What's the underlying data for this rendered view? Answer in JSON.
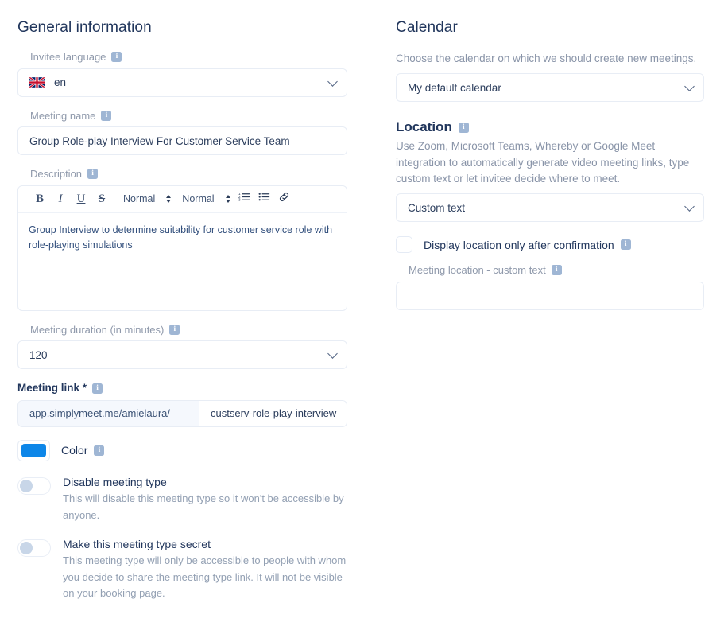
{
  "left": {
    "section_title": "General information",
    "invitee_language": {
      "label": "Invitee language",
      "value": "en",
      "flag": "uk-flag-icon"
    },
    "meeting_name": {
      "label": "Meeting name",
      "value": "Group Role-play Interview For Customer Service Team"
    },
    "description": {
      "label": "Description",
      "toolbar": {
        "bold": "B",
        "italic": "I",
        "underline": "U",
        "strike": "S",
        "font_select": "Normal",
        "size_select": "Normal"
      },
      "value": "Group Interview to determine suitability for customer service role with role-playing simulations"
    },
    "meeting_duration": {
      "label": "Meeting duration (in minutes)",
      "value": "120"
    },
    "meeting_link": {
      "label": "Meeting link *",
      "prefix": "app.simplymeet.me/amielaura/",
      "slug": "custserv-role-play-interview"
    },
    "color": {
      "label": "Color",
      "value": "#0d86e8"
    },
    "disable_meeting_type": {
      "title": "Disable meeting type",
      "description": "This will disable this meeting type so it won't be accessible by anyone.",
      "state": "off"
    },
    "secret_meeting_type": {
      "title": "Make this meeting type secret",
      "description": "This meeting type will only be accessible to people with whom you decide to share the meeting type link. It will not be visible on your booking page.",
      "state": "off"
    }
  },
  "right": {
    "calendar": {
      "section_title": "Calendar",
      "helper": "Choose the calendar on which we should create new meetings.",
      "value": "My default calendar"
    },
    "location": {
      "section_title": "Location",
      "helper": "Use Zoom, Microsoft Teams, Whereby or Google Meet integration to automatically generate video meeting links, type custom text or let invitee decide where to meet.",
      "value": "Custom text",
      "display_after_confirmation": {
        "label": "Display location only after confirmation",
        "checked": "false"
      },
      "custom_text": {
        "label": "Meeting location - custom text",
        "value": "",
        "placeholder": ""
      }
    }
  },
  "icons": {
    "info": "i",
    "chevron_down": "chevron-down-icon"
  }
}
